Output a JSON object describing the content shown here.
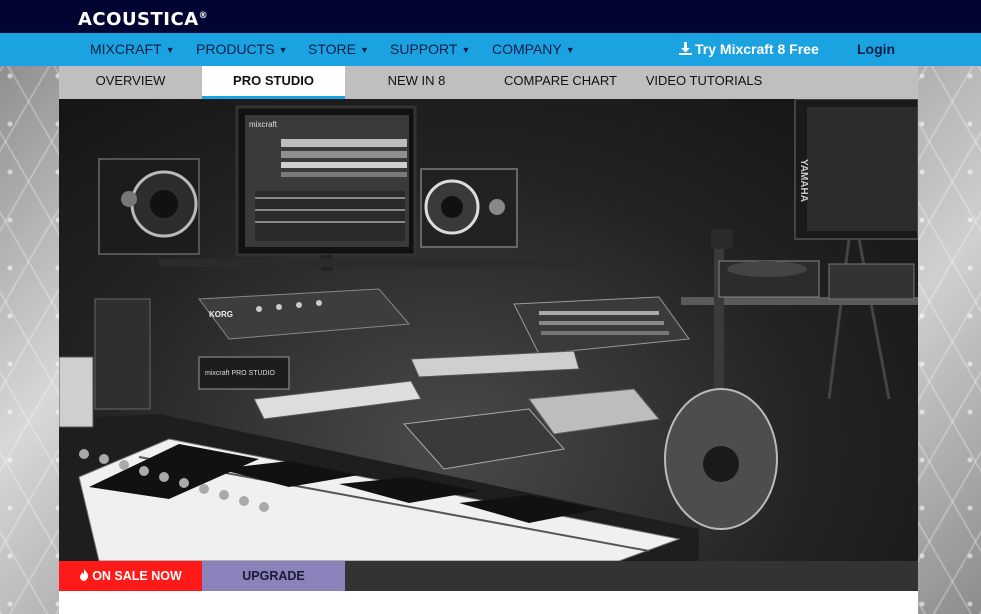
{
  "brand": {
    "name": "ACOUSTICA",
    "mark": "®"
  },
  "nav": {
    "items": [
      {
        "label": "MIXCRAFT"
      },
      {
        "label": "PRODUCTS"
      },
      {
        "label": "STORE"
      },
      {
        "label": "SUPPORT"
      },
      {
        "label": "COMPANY"
      }
    ],
    "try_label": "Try Mixcraft 8 Free",
    "login_label": "Login"
  },
  "subnav": {
    "items": [
      {
        "label": "OVERVIEW"
      },
      {
        "label": "PRO STUDIO",
        "active": true
      },
      {
        "label": "NEW IN 8"
      },
      {
        "label": "COMPARE CHART"
      },
      {
        "label": "VIDEO TUTORIALS"
      }
    ]
  },
  "hero": {
    "screen_label": "mixcraft",
    "keyboard_brand": "KORG",
    "box_label": "mixcraft PRO STUDIO",
    "speaker_brand": "YAMAHA"
  },
  "promo": {
    "sale_label": "ON SALE NOW",
    "upgrade_label": "UPGRADE"
  },
  "colors": {
    "topbar": "#020531",
    "navbar": "#1aa3e0",
    "sale": "#ff1a1a",
    "upgrade": "#8a82b8"
  }
}
